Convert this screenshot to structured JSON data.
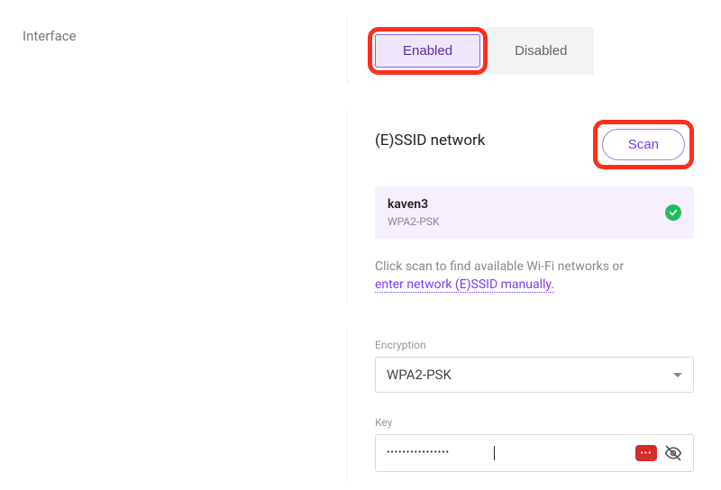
{
  "interface": {
    "label": "Interface",
    "enabled": "Enabled",
    "disabled": "Disabled",
    "active": "enabled"
  },
  "ssid": {
    "title": "(E)SSID network",
    "scan": "Scan",
    "selected": {
      "name": "kaven3",
      "encryption": "WPA2-PSK"
    },
    "hint_prefix": "Click scan to find available Wi-Fi networks or ",
    "hint_link": "enter network (E)SSID manually."
  },
  "fields": {
    "encryption_label": "Encryption",
    "encryption_value": "WPA2-PSK",
    "key_label": "Key",
    "key_value": "••••••••••••••••"
  }
}
